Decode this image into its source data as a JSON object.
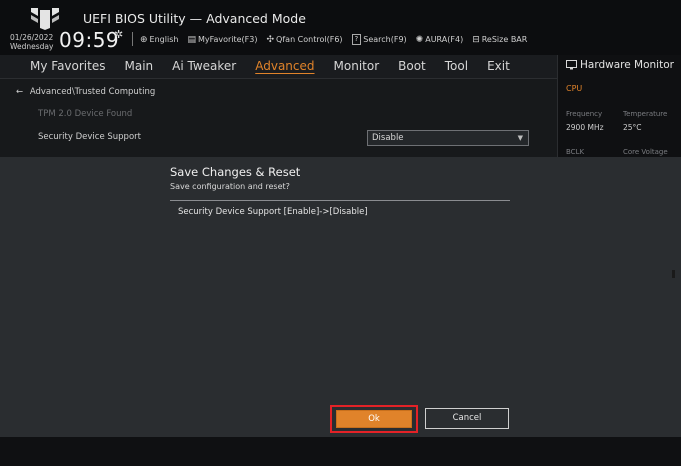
{
  "header": {
    "app_title": "UEFI BIOS Utility — Advanced Mode",
    "date": "01/26/2022",
    "weekday": "Wednesday",
    "time": "09:59",
    "toolbar": [
      {
        "icon": "globe-icon",
        "glyph": "⊕",
        "label": "English"
      },
      {
        "icon": "favorite-icon",
        "glyph": "▤",
        "label": "MyFavorite(F3)"
      },
      {
        "icon": "fan-icon",
        "glyph": "✣",
        "label": "Qfan Control(F6)"
      },
      {
        "icon": "help-icon",
        "glyph": "?",
        "label": "Search(F9)"
      },
      {
        "icon": "aura-icon",
        "glyph": "✺",
        "label": "AURA(F4)"
      },
      {
        "icon": "resize-bar-icon",
        "glyph": "⊟",
        "label": "ReSize BAR"
      }
    ]
  },
  "menu": {
    "items": [
      "My Favorites",
      "Main",
      "Ai Tweaker",
      "Advanced",
      "Monitor",
      "Boot",
      "Tool",
      "Exit"
    ],
    "active": "Advanced"
  },
  "main": {
    "breadcrumb": "Advanced\\Trusted Computing",
    "tpm_status": "TPM 2.0 Device Found",
    "setting_label": "Security Device Support",
    "setting_value": "Disable"
  },
  "hardware_monitor": {
    "title": "Hardware Monitor",
    "section": "CPU",
    "frequency_label": "Frequency",
    "frequency_value": "2900 MHz",
    "temperature_label": "Temperature",
    "temperature_value": "25°C",
    "bclk_label": "BCLK",
    "core_voltage_label": "Core Voltage"
  },
  "dialog": {
    "title": "Save Changes & Reset",
    "subtitle": "Save configuration and reset?",
    "change": "Security Device Support [Enable]->[Disable]",
    "ok_label": "Ok",
    "cancel_label": "Cancel"
  },
  "colors": {
    "accent": "#e0832a",
    "highlight_border": "#e32227"
  }
}
